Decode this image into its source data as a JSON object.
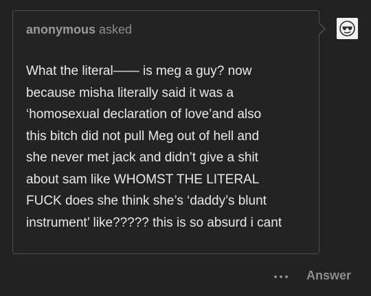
{
  "ask": {
    "asker_name": "anonymous",
    "asked_label": "asked",
    "question_lines": [
      "What the literal—— is meg a guy? now",
      "because misha literally said it was a",
      "‘homosexual declaration of love’and also",
      "this bitch did not pull Meg out of hell and",
      "she never met jack and didn’t give a shit",
      "about sam like WHOMST THE LITERAL",
      "FUCK does she think she’s ‘daddy’s blunt",
      "instrument’ like????? this is so absurd i cant"
    ]
  },
  "avatar": {
    "icon": "anonymous-sunglasses-face-icon"
  },
  "footer": {
    "more_icon": "ellipsis-icon",
    "answer_label": "Answer"
  },
  "colors": {
    "background": "#222223",
    "bubble_border": "#4e4e4f",
    "question_text": "#e9e9e9",
    "muted_text": "#8d8d8e"
  }
}
